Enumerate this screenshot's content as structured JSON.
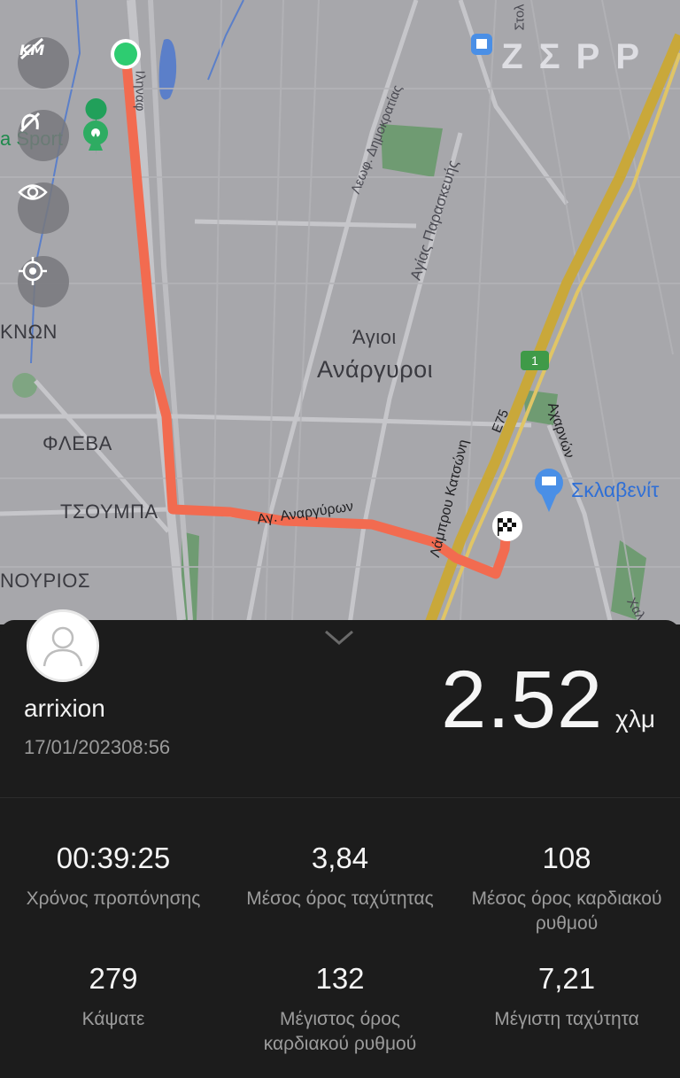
{
  "map": {
    "brand": "ΖΣΡΡ",
    "districts": {
      "agioi_anargyroi_line1": "Άγιοι",
      "agioi_anargyroi_line2": "Ανάργυροι",
      "fleva": "ΦΛΕΒΑ",
      "tsoumpa": "ΤΣΟΥΜΠΑ",
      "knon": "ΚΝΩΝ",
      "noyrios": "ΝΟΥΡΙΟΣ"
    },
    "streets": {
      "dimokratias": "Λεωφ. Δημοκρατίας",
      "paraskevis": "Αγίας Παρασκευής",
      "anargyron": "Αγ. Αναργύρων",
      "katsoni": "Λάμπρου Κατσώνη",
      "acharnon": "Αχαρνών",
      "trains": "Ιληναφ",
      "stoli": "Στολ",
      "xal": "Χαλ"
    },
    "pois": {
      "sport": "a Sport",
      "skl": "Σκλαβενίτ"
    },
    "road_shields": {
      "one": "1",
      "e75": "E75"
    },
    "controls": [
      "km-toggle-icon",
      "hide-route-icon",
      "eye-icon",
      "locate-icon"
    ],
    "colors": {
      "route": "#f26b50",
      "start": "#2ecc71",
      "highway": "#c9a83a"
    }
  },
  "panel": {
    "username": "arrixion",
    "datetime": "17/01/202308:56",
    "distance_value": "2.52",
    "distance_unit": "χλμ",
    "stats": [
      {
        "value": "00:39:25",
        "label": "Χρόνος προπόνησης"
      },
      {
        "value": "3,84",
        "label": "Μέσος όρος ταχύτητας"
      },
      {
        "value": "108",
        "label": "Μέσος όρος καρδιακού\nρυθμού"
      },
      {
        "value": "279",
        "label": "Κάψατε"
      },
      {
        "value": "132",
        "label": "Μέγιστος όρος\nκαρδιακού ρυθμού"
      },
      {
        "value": "7,21",
        "label": "Μέγιστη ταχύτητα"
      }
    ]
  }
}
